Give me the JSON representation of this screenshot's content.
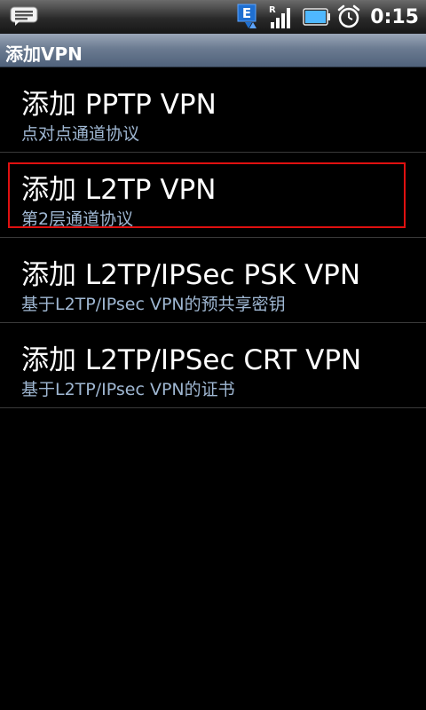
{
  "status_bar": {
    "notification_icon": "chat-bubble-icon",
    "network_icon": "e-data-icon",
    "network_label": "E",
    "roaming_label": "R",
    "signal_icon": "signal-icon",
    "battery_icon": "battery-icon",
    "alarm_icon": "alarm-clock-icon",
    "time": "0:15"
  },
  "title_bar": {
    "title": "添加VPN"
  },
  "vpn_options": [
    {
      "title": "添加 PPTP VPN",
      "subtitle": "点对点通道协议"
    },
    {
      "title": "添加 L2TP VPN",
      "subtitle": "第2层通道协议"
    },
    {
      "title": "添加 L2TP/IPSec PSK VPN",
      "subtitle": "基于L2TP/IPsec VPN的预共享密钥"
    },
    {
      "title": "添加 L2TP/IPSec CRT VPN",
      "subtitle": "基于L2TP/IPsec VPN的证书"
    }
  ],
  "colors": {
    "background": "#000000",
    "title_bar": "#6b7b91",
    "subtitle_text": "#9fb7d2",
    "highlight": "#e01010",
    "battery": "#4fb8ff"
  }
}
